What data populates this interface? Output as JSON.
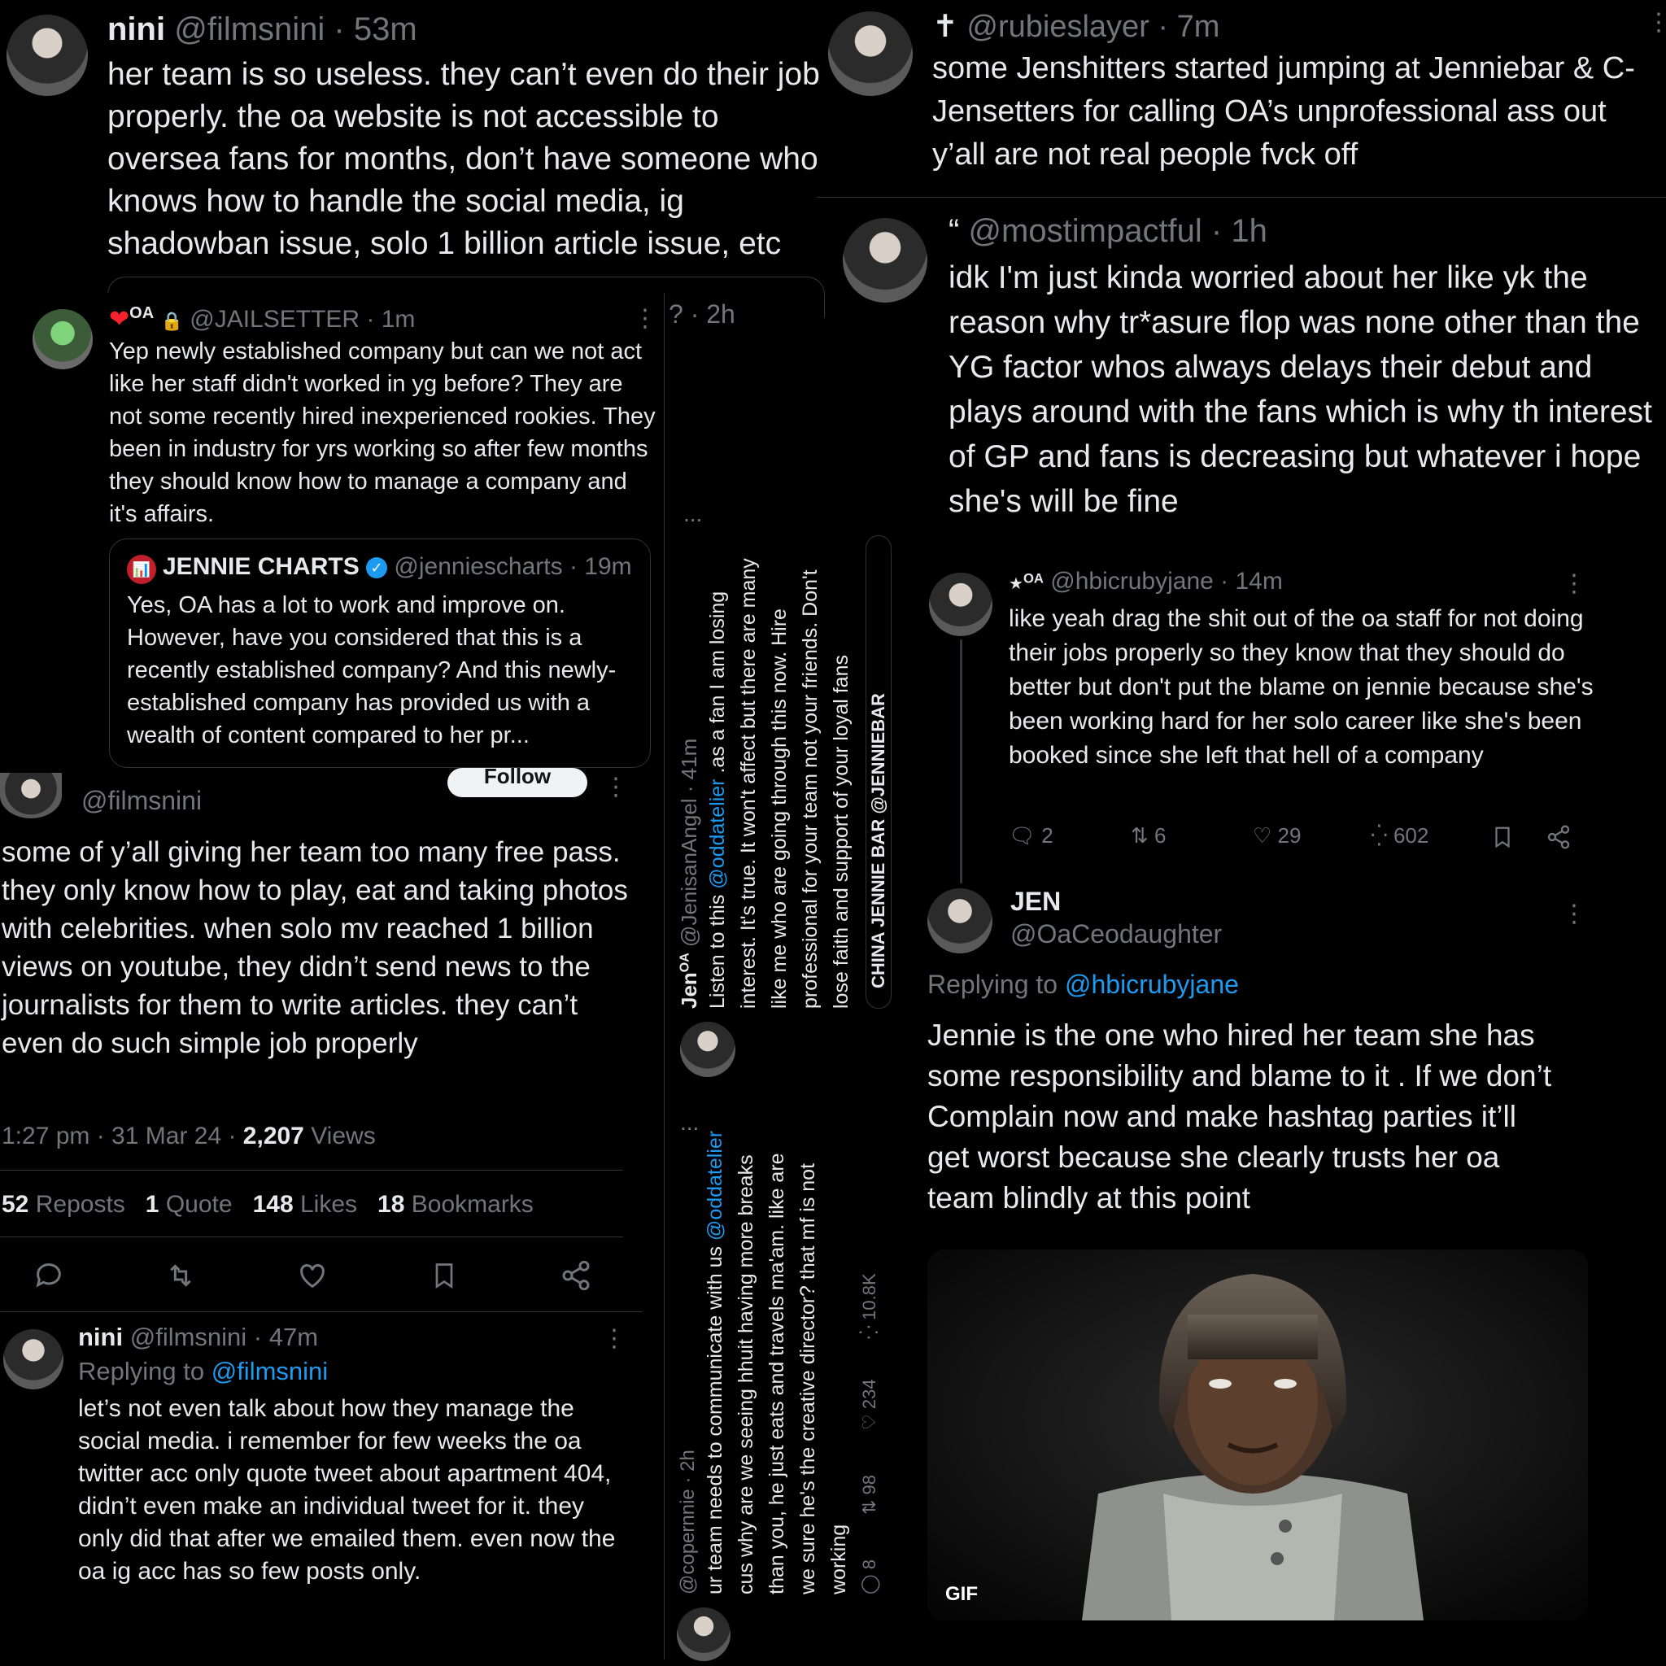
{
  "p1": {
    "name": "nini",
    "meta": "@filmsnini · 53m",
    "text": "her team is so useless. they can’t even do their job properly. the oa website is not accessible to oversea fans for months, don’t have someone who knows how to handle the social media, ig shadowban issue, solo 1 billion article issue, etc",
    "clipped": "? · 2h"
  },
  "p2": {
    "badge": "OA",
    "handle": "@JAILSETTER · 1m",
    "text": "Yep newly established company but can we not act like her staff didn't worked in yg before? They are not some recently hired inexperienced rookies. They been in industry for yrs working so after few months they should know how to manage a company and it's affairs.",
    "quote": {
      "name": "JENNIE CHARTS",
      "meta": "@jenniescharts · 19m",
      "text": "Yes, OA has a lot to work and improve on. However, have you considered that this is a recently established company? And this newly-established company has provided us with a wealth of content compared to her pr..."
    }
  },
  "p3": {
    "follow_label": "Follow",
    "handle": "@filmsnini",
    "text": "some of y’all giving her team too many free pass. they only know how to play, eat and taking photos with celebrities. when solo mv reached 1 billion views on youtube, they didn’t send news to the journalists for them to write articles. they can’t even do such simple job properly",
    "time": "1:27 pm · 31 Mar 24 · ",
    "views_num": "2,207",
    "views_label": " Views",
    "stats": [
      {
        "num": "52",
        "label": "Reposts"
      },
      {
        "num": "1",
        "label": "Quote"
      },
      {
        "num": "148",
        "label": "Likes"
      },
      {
        "num": "18",
        "label": "Bookmarks"
      }
    ]
  },
  "p4": {
    "name": "nini",
    "meta": "@filmsnini · 47m",
    "reply_prefix": "Replying to ",
    "reply_to": "@filmsnini",
    "text": "let’s not even talk about how they manage the social media. i remember for few weeks the oa twitter acc only quote tweet about apartment 404, didn’t even make an individual tweet for it. they only did that after we emailed them. even now the oa ig acc has so few posts only."
  },
  "rot1": {
    "name": "Jen",
    "badge": "OA",
    "meta": "@JenisanAngel · 41m",
    "text_pre": "Listen to this ",
    "mention": "@oddatelier",
    "text_post": " .as a fan I am losing interest. It's true. It won't affect but there are many like me who are going through this now. Hire professional for your team not your friends. Don't lose faith and support of your loyal fans",
    "quote_name": "CHINA JENNIE BAR @JENNIEBAR",
    "dots": "..."
  },
  "rot2": {
    "meta": "@copernnie · 2h",
    "text_pre": "ur team needs to communicate with us ",
    "mention": "@oddatelier",
    "text_post": " cus why are we seeing hhuit having more breaks than you, he just eats and travels ma'am. like are we sure he's the creative director? that mf is not working",
    "stats": [
      "8",
      "98",
      "234",
      "10.8K"
    ],
    "dots": "..."
  },
  "p5": {
    "handle": "@rubieslayer · 7m",
    "text": "some Jenshitters started jumping at Jenniebar & C-Jensetters for calling OA’s unprofessional ass out y’all are not real people fvck off"
  },
  "p6": {
    "handle": "@mostimpactful · 1h",
    "text": "idk I'm just kinda worried about her like yk the reason why tr*asure flop was none other than the YG factor whos always delays their debut and plays around with the fans which is why th interest of GP and fans is decreasing but whatever i hope she's will be fine"
  },
  "p7": {
    "badge": "OA",
    "meta": "@hbicrubyjane · 14m",
    "text": "like yeah drag the shit out of the oa staff for not doing their jobs properly so they know that they should do better but don't put the blame on jennie because she's been working hard for her solo career like she's been booked since she left that hell of a company",
    "stats": {
      "replies": "2",
      "reposts": "6",
      "likes": "29",
      "views": "602"
    }
  },
  "p8": {
    "name": "JEN",
    "handle": "@OaCeodaughter",
    "reply_prefix": "Replying to ",
    "reply_to": "@hbicrubyjane",
    "text": "Jennie is the one who hired her team she has some responsibility and blame to it .  If we don’t Complain now and make hashtag parties it’ll get worst because she clearly trusts her oa team blindly at this point",
    "gif_label": "GIF"
  },
  "colors": {
    "bg": "#000000",
    "text": "#e7e9ea",
    "muted": "#71767b",
    "accent": "#1d9bf0",
    "like": "#f91880",
    "verified": "#1d9bf0"
  }
}
